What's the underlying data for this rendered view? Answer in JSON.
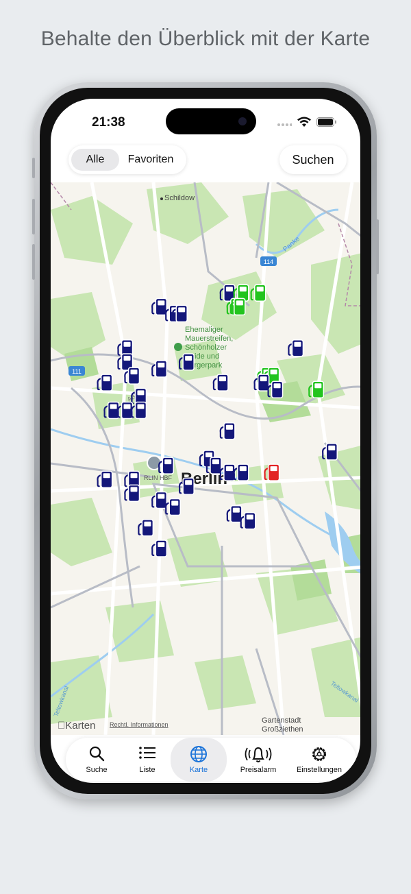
{
  "headline": "Behalte den Überblick mit der Karte",
  "status": {
    "time": "21:38"
  },
  "filter": {
    "options": [
      "Alle",
      "Favoriten"
    ],
    "selected": "Alle"
  },
  "search_button": "Suchen",
  "map": {
    "center_label": "Berlin",
    "places": {
      "schildow": "Schildow",
      "panke": "Panke",
      "road_114": "114",
      "road_111": "111",
      "road_a": "ABE",
      "park": [
        "Ehemaliger",
        "Mauerstreifen,",
        "Schönholzer",
        "Heide und",
        "Bürgerpark"
      ],
      "hbf": "RLIN HBF",
      "teltowkanal_left": "Teltowkanal",
      "teltowkanal_right": "Teltowkanal",
      "gartenstadt": [
        "Gartenstadt",
        "Großziethen"
      ]
    },
    "attribution": "Karten",
    "legal": "Rechtl. Informationen",
    "station_colors": {
      "default": "#14177a",
      "cheap": "#22c41e",
      "expensive": "#e22424"
    },
    "stations": [
      {
        "lat": 52.62,
        "lng": 13.41,
        "status": "default"
      },
      {
        "lat": 52.62,
        "lng": 13.43,
        "status": "cheap"
      },
      {
        "lat": 52.62,
        "lng": 13.455,
        "status": "cheap"
      },
      {
        "lat": 52.61,
        "lng": 13.42,
        "status": "cheap"
      },
      {
        "lat": 52.61,
        "lng": 13.425,
        "status": "cheap"
      },
      {
        "lat": 52.61,
        "lng": 13.31,
        "status": "default"
      },
      {
        "lat": 52.605,
        "lng": 13.33,
        "status": "default"
      },
      {
        "lat": 52.605,
        "lng": 13.34,
        "status": "default"
      },
      {
        "lat": 52.58,
        "lng": 13.51,
        "status": "default"
      },
      {
        "lat": 52.58,
        "lng": 13.26,
        "status": "default"
      },
      {
        "lat": 52.57,
        "lng": 13.26,
        "status": "default"
      },
      {
        "lat": 52.57,
        "lng": 13.35,
        "status": "default"
      },
      {
        "lat": 52.565,
        "lng": 13.31,
        "status": "default"
      },
      {
        "lat": 52.56,
        "lng": 13.27,
        "status": "default"
      },
      {
        "lat": 52.555,
        "lng": 13.23,
        "status": "default"
      },
      {
        "lat": 52.56,
        "lng": 13.465,
        "status": "cheap"
      },
      {
        "lat": 52.56,
        "lng": 13.475,
        "status": "cheap"
      },
      {
        "lat": 52.555,
        "lng": 13.46,
        "status": "default"
      },
      {
        "lat": 52.55,
        "lng": 13.48,
        "status": "default"
      },
      {
        "lat": 52.55,
        "lng": 13.54,
        "status": "cheap"
      },
      {
        "lat": 52.555,
        "lng": 13.4,
        "status": "default"
      },
      {
        "lat": 52.545,
        "lng": 13.28,
        "status": "default"
      },
      {
        "lat": 52.535,
        "lng": 13.24,
        "status": "default"
      },
      {
        "lat": 52.535,
        "lng": 13.26,
        "status": "default"
      },
      {
        "lat": 52.535,
        "lng": 13.28,
        "status": "default"
      },
      {
        "lat": 52.52,
        "lng": 13.41,
        "status": "default"
      },
      {
        "lat": 52.505,
        "lng": 13.56,
        "status": "default"
      },
      {
        "lat": 52.5,
        "lng": 13.38,
        "status": "default"
      },
      {
        "lat": 52.495,
        "lng": 13.39,
        "status": "default"
      },
      {
        "lat": 52.495,
        "lng": 13.32,
        "status": "default"
      },
      {
        "lat": 52.49,
        "lng": 13.41,
        "status": "default"
      },
      {
        "lat": 52.49,
        "lng": 13.43,
        "status": "default"
      },
      {
        "lat": 52.49,
        "lng": 13.475,
        "status": "expensive"
      },
      {
        "lat": 52.485,
        "lng": 13.27,
        "status": "default"
      },
      {
        "lat": 52.485,
        "lng": 13.23,
        "status": "default"
      },
      {
        "lat": 52.48,
        "lng": 13.35,
        "status": "default"
      },
      {
        "lat": 52.475,
        "lng": 13.27,
        "status": "default"
      },
      {
        "lat": 52.47,
        "lng": 13.31,
        "status": "default"
      },
      {
        "lat": 52.465,
        "lng": 13.33,
        "status": "default"
      },
      {
        "lat": 52.46,
        "lng": 13.42,
        "status": "default"
      },
      {
        "lat": 52.455,
        "lng": 13.44,
        "status": "default"
      },
      {
        "lat": 52.45,
        "lng": 13.29,
        "status": "default"
      },
      {
        "lat": 52.435,
        "lng": 13.31,
        "status": "default"
      }
    ]
  },
  "tabs": [
    {
      "label": "Suche",
      "icon": "magnifier-icon",
      "active": false
    },
    {
      "label": "Liste",
      "icon": "list-icon",
      "active": false
    },
    {
      "label": "Karte",
      "icon": "globe-icon",
      "active": true
    },
    {
      "label": "Preisalarm",
      "icon": "bell-icon",
      "active": false
    },
    {
      "label": "Einstellungen",
      "icon": "gear-icon",
      "active": false
    }
  ]
}
